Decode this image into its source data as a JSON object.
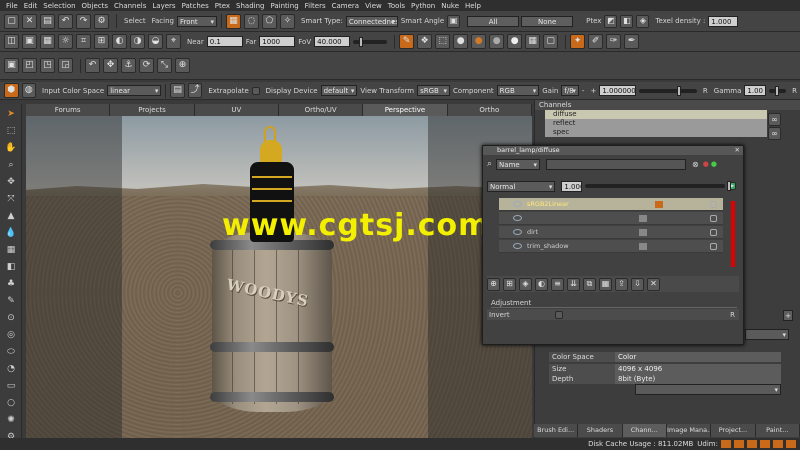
{
  "menu": [
    "File",
    "Edit",
    "Selection",
    "Objects",
    "Channels",
    "Layers",
    "Patches",
    "Ptex",
    "Shading",
    "Painting",
    "Filters",
    "Camera",
    "View",
    "Tools",
    "Python",
    "Nuke",
    "Help"
  ],
  "toolbar1": {
    "select_label": "Select",
    "facing_label": "Facing",
    "facing_value": "Front",
    "smart_type_label": "Smart Type:",
    "smart_type_value": "Connectedness",
    "smart_angle_label": "Smart Angle",
    "all_button": "All",
    "none_button": "None",
    "ptex_label": "Ptex",
    "texel_label": "Texel density :",
    "texel_value": "1.000"
  },
  "toolbar2": {
    "near_label": "Near",
    "near_value": "0.1",
    "far_label": "Far",
    "far_value": "1000",
    "fov_label": "FoV",
    "fov_value": "40.000"
  },
  "toolbar4": {
    "input_color_space_label": "Input Color Space",
    "input_color_space_value": "linear",
    "extrapolate_label": "Extrapolate",
    "display_device_label": "Display Device",
    "display_device_value": "default",
    "view_transform_label": "View Transform",
    "view_transform_value": "sRGB",
    "component_label": "Component",
    "component_value": "RGB",
    "gain_label": "Gain",
    "gain_value": "f/8",
    "gain_number": "1.000000",
    "gamma_label": "Gamma",
    "gamma_value": "1.00",
    "r_label": "R"
  },
  "view_tabs": [
    "Forums",
    "Projects",
    "UV",
    "Ortho/UV",
    "Perspective",
    "Ortho"
  ],
  "active_view_tab": "Perspective",
  "watermark": "www.cgtsj.com",
  "barrel_text": "WOODYS",
  "channels": {
    "header": "Channels",
    "items": [
      "diffuse",
      "reflect",
      "spec"
    ]
  },
  "layer_window": {
    "title": "barrel_lamp/diffuse",
    "filter_value": "Name",
    "blend_mode": "Normal",
    "opacity": "1.000",
    "layers": [
      {
        "name": "sRGB2Linear",
        "selected": true
      },
      {
        "name": "",
        "selected": false
      },
      {
        "name": "dirt",
        "selected": false
      },
      {
        "name": "trim_shadow",
        "selected": false
      }
    ],
    "adjustment_header": "Adjustment",
    "invert_label": "Invert",
    "r_label": "R"
  },
  "properties": {
    "color_space_label": "Color Space",
    "color_space_value": "Color",
    "size_label": "Size",
    "size_value": "4096 x 4096",
    "depth_label": "Depth",
    "depth_value": "8bit (Byte)"
  },
  "bottom_tabs": [
    "Brush Edi...",
    "Shaders",
    "Chann...",
    "Image Mana...",
    "Project...",
    "Paint..."
  ],
  "active_bottom_tab": "Chann...",
  "status": {
    "disk_cache": "Disk Cache Usage : 811.02MB",
    "udim": "Udim:"
  },
  "colors": {
    "accent": "#c86a1a",
    "watermark": "#f2f000",
    "selection": "#c9c9b2",
    "lamp": "#d4a820"
  }
}
